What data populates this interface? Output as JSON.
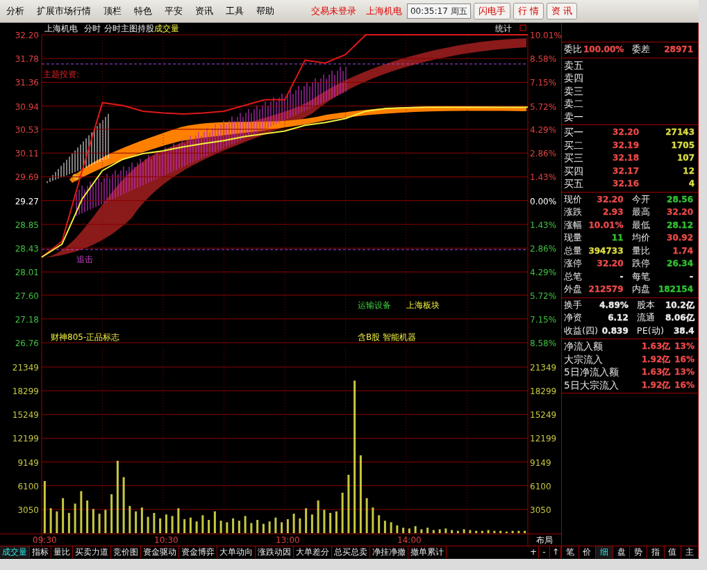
{
  "menu": {
    "items": [
      "分析",
      "扩展市场行情",
      "顶栏",
      "特色",
      "平安",
      "资讯",
      "工具",
      "帮助"
    ],
    "status": [
      "交易未登录",
      "上海机电"
    ],
    "clock": "00:35:17 周五",
    "buttons": [
      "闪电手",
      "行 情",
      "资 讯"
    ]
  },
  "price_chart": {
    "header": {
      "symbol": "上海机电",
      "mode": "分时",
      "overlay": "分时主图持股",
      "indicator": "成交量",
      "stats": "统计"
    },
    "percent_labels": [
      "10.01%",
      "8.58%",
      "7.15%",
      "5.72%",
      "4.29%",
      "2.86%",
      "1.43%",
      "0.00%",
      "1.43%",
      "2.86%",
      "4.29%",
      "5.72%",
      "7.15%",
      "8.58%"
    ],
    "labels": [
      {
        "text": "主题投资:",
        "kind": "theme"
      },
      {
        "text": "追击",
        "kind": "signal"
      },
      {
        "text": "财神805-正品标志",
        "kind": "brand"
      },
      {
        "text": "运输设备",
        "kind": "industry"
      },
      {
        "text": "上海板块",
        "kind": "region"
      },
      {
        "text": "含B股 智能机器",
        "kind": "concept"
      }
    ],
    "chart_data": {
      "type": "line",
      "grid": true,
      "series": [
        {
          "color": "#e01818",
          "values": [
            28.27,
            28.55,
            29.8,
            31.0,
            30.95,
            30.85,
            30.82,
            30.8,
            30.82,
            30.85,
            30.95,
            31.05,
            31.05,
            31.75,
            31.7,
            31.85,
            32.2,
            32.2,
            32.2,
            32.2,
            32.2,
            32.2,
            32.2,
            32.2,
            32.2
          ]
        },
        {
          "color": "#f0f040",
          "values": [
            28.27,
            28.5,
            29.3,
            29.8,
            30.0,
            30.1,
            30.15,
            30.22,
            30.28,
            30.33,
            30.4,
            30.45,
            30.5,
            30.6,
            30.65,
            30.72,
            30.85,
            30.9,
            30.91,
            30.92,
            30.92,
            30.92,
            30.92,
            30.92,
            30.92
          ]
        }
      ],
      "ylim": [
        26.76,
        32.2
      ],
      "yticks": [
        {
          "value": 32.2,
          "label": "32.20"
        },
        {
          "value": 31.78,
          "label": "31.78"
        },
        {
          "value": 31.36,
          "label": "31.36"
        },
        {
          "value": 30.94,
          "label": "30.94"
        },
        {
          "value": 30.53,
          "label": "30.53"
        },
        {
          "value": 30.11,
          "label": "30.11"
        },
        {
          "value": 29.69,
          "label": "29.69"
        },
        {
          "value": 29.27,
          "label": "29.27"
        },
        {
          "value": 28.85,
          "label": "28.85"
        },
        {
          "value": 28.43,
          "label": "28.43"
        },
        {
          "value": 28.01,
          "label": "28.01"
        },
        {
          "value": 27.6,
          "label": "27.60"
        },
        {
          "value": 27.18,
          "label": "27.18"
        },
        {
          "value": 26.76,
          "label": "26.76"
        }
      ]
    }
  },
  "volume_chart": {
    "right_labels": [
      "21349",
      "18299",
      "15249",
      "12199",
      "9149",
      "6100",
      "3050"
    ],
    "layout_button": "布局",
    "chart_data": {
      "type": "bar",
      "grid": true,
      "categories": [
        "09:30",
        null,
        null,
        null,
        null,
        null,
        null,
        null,
        null,
        null,
        null,
        null,
        null,
        null,
        null,
        null,
        null,
        null,
        null,
        null,
        "10:30",
        null,
        null,
        null,
        null,
        null,
        null,
        null,
        null,
        null,
        null,
        null,
        null,
        null,
        null,
        null,
        null,
        null,
        null,
        null,
        "13:00",
        null,
        null,
        null,
        null,
        null,
        null,
        null,
        null,
        null,
        null,
        null,
        null,
        null,
        null,
        null,
        null,
        null,
        null,
        null,
        "14:00",
        null,
        null,
        null,
        null,
        null,
        null,
        null,
        null,
        null,
        null,
        null,
        null,
        null,
        null,
        null,
        null,
        null,
        null,
        null
      ],
      "values": [
        6700,
        3200,
        2800,
        4500,
        2600,
        3800,
        5400,
        4200,
        3100,
        2500,
        3000,
        5000,
        9300,
        7200,
        3500,
        2800,
        3300,
        2100,
        2600,
        1900,
        2400,
        2200,
        3200,
        1800,
        2000,
        1500,
        2300,
        1700,
        2800,
        1600,
        1400,
        1900,
        1600,
        2200,
        1300,
        1700,
        1200,
        1500,
        2000,
        1400,
        1800,
        2500,
        1900,
        3200,
        2400,
        4200,
        3000,
        2600,
        2800,
        5200,
        7500,
        19600,
        10000,
        4500,
        3300,
        2300,
        1600,
        1400,
        1000,
        700,
        600,
        900,
        500,
        700,
        400,
        500,
        600,
        400,
        300,
        500,
        400,
        300,
        300,
        400,
        300,
        300,
        200,
        300,
        300,
        300
      ],
      "ylim": [
        0,
        21349
      ],
      "yticks": [
        {
          "value": 21349,
          "label": "21349"
        },
        {
          "value": 18299,
          "label": "18299"
        },
        {
          "value": 15249,
          "label": "15249"
        },
        {
          "value": 12199,
          "label": "12199"
        },
        {
          "value": 9149,
          "label": "9149"
        },
        {
          "value": 6100,
          "label": "6100"
        },
        {
          "value": 3050,
          "label": "3050"
        }
      ]
    }
  },
  "quote_panel": {
    "order_ratio": [
      {
        "label": "委比",
        "value": "100.00%",
        "color": "#e84848"
      },
      {
        "label": "委差",
        "value": "28971",
        "color": "#e84848"
      }
    ],
    "asks": [
      "卖五",
      "卖四",
      "卖三",
      "卖二",
      "卖一"
    ],
    "bids": [
      {
        "label": "买一",
        "price": "32.20",
        "volume": "27143"
      },
      {
        "label": "买二",
        "price": "32.19",
        "volume": "1705"
      },
      {
        "label": "买三",
        "price": "32.18",
        "volume": "107"
      },
      {
        "label": "买四",
        "price": "32.17",
        "volume": "12"
      },
      {
        "label": "买五",
        "price": "32.16",
        "volume": "4"
      }
    ],
    "stats": [
      {
        "label": "现价",
        "value": "32.20",
        "color": "#e84848"
      },
      {
        "label": "今开",
        "value": "28.56",
        "color": "#30c030"
      },
      {
        "label": "涨跌",
        "value": "2.93",
        "color": "#e84848"
      },
      {
        "label": "最高",
        "value": "32.20",
        "color": "#e84848"
      },
      {
        "label": "涨幅",
        "value": "10.01%",
        "color": "#e84848"
      },
      {
        "label": "最低",
        "value": "28.12",
        "color": "#30c030"
      },
      {
        "label": "现量",
        "value": "11",
        "color": "#30c030"
      },
      {
        "label": "均价",
        "value": "30.92",
        "color": "#e84848"
      },
      {
        "label": "总量",
        "value": "394733",
        "color": "#d8d840"
      },
      {
        "label": "量比",
        "value": "1.74",
        "color": "#e84848"
      },
      {
        "label": "涨停",
        "value": "32.20",
        "color": "#e84848"
      },
      {
        "label": "跌停",
        "value": "26.34",
        "color": "#30c030"
      },
      {
        "label": "总笔",
        "value": "-",
        "color": "#e8e8e8"
      },
      {
        "label": "每笔",
        "value": "-",
        "color": "#e8e8e8"
      },
      {
        "label": "外盘",
        "value": "212579",
        "color": "#e84848"
      },
      {
        "label": "内盘",
        "value": "182154",
        "color": "#30c030"
      }
    ],
    "fundamentals": [
      {
        "label": "换手",
        "value": "4.89%"
      },
      {
        "label": "股本",
        "value": "10.2亿"
      },
      {
        "label": "净资",
        "value": "6.12"
      },
      {
        "label": "流通",
        "value": "8.06亿"
      },
      {
        "label": "收益(四)",
        "value": "0.839"
      },
      {
        "label": "PE(动)",
        "value": "38.4"
      }
    ],
    "flows": [
      {
        "label": "净流入额",
        "amount": "1.63亿",
        "pct": "13%"
      },
      {
        "label": "大宗流入",
        "amount": "1.92亿",
        "pct": "16%"
      },
      {
        "label": "5日净流入额",
        "amount": "1.63亿",
        "pct": "13%"
      },
      {
        "label": "5日大宗流入",
        "amount": "1.92亿",
        "pct": "16%"
      }
    ]
  },
  "bottom_tabs": [
    {
      "label": "成交量",
      "selected": true
    },
    {
      "label": "指标",
      "selected": false
    },
    {
      "label": "量比",
      "selected": false
    },
    {
      "label": "买卖力道",
      "selected": false
    },
    {
      "label": "竞价图",
      "selected": false
    },
    {
      "label": "资金驱动",
      "selected": false
    },
    {
      "label": "资金博弈",
      "selected": false
    },
    {
      "label": "大单动向",
      "selected": false
    },
    {
      "label": "涨跌动因",
      "selected": false
    },
    {
      "label": "大单差分",
      "selected": false
    },
    {
      "label": "总买总卖",
      "selected": false
    },
    {
      "label": "净挂净撤",
      "selected": false
    },
    {
      "label": "撤单累计",
      "selected": false
    }
  ],
  "zoom_buttons": [
    "+",
    "-",
    "↑"
  ],
  "panel_tabs": [
    {
      "label": "笔",
      "selected": false
    },
    {
      "label": "价",
      "selected": false
    },
    {
      "label": "细",
      "selected": true
    },
    {
      "label": "盘",
      "selected": false
    },
    {
      "label": "势",
      "selected": false
    },
    {
      "label": "指",
      "selected": false
    },
    {
      "label": "值",
      "selected": false
    },
    {
      "label": "主",
      "selected": false
    }
  ]
}
